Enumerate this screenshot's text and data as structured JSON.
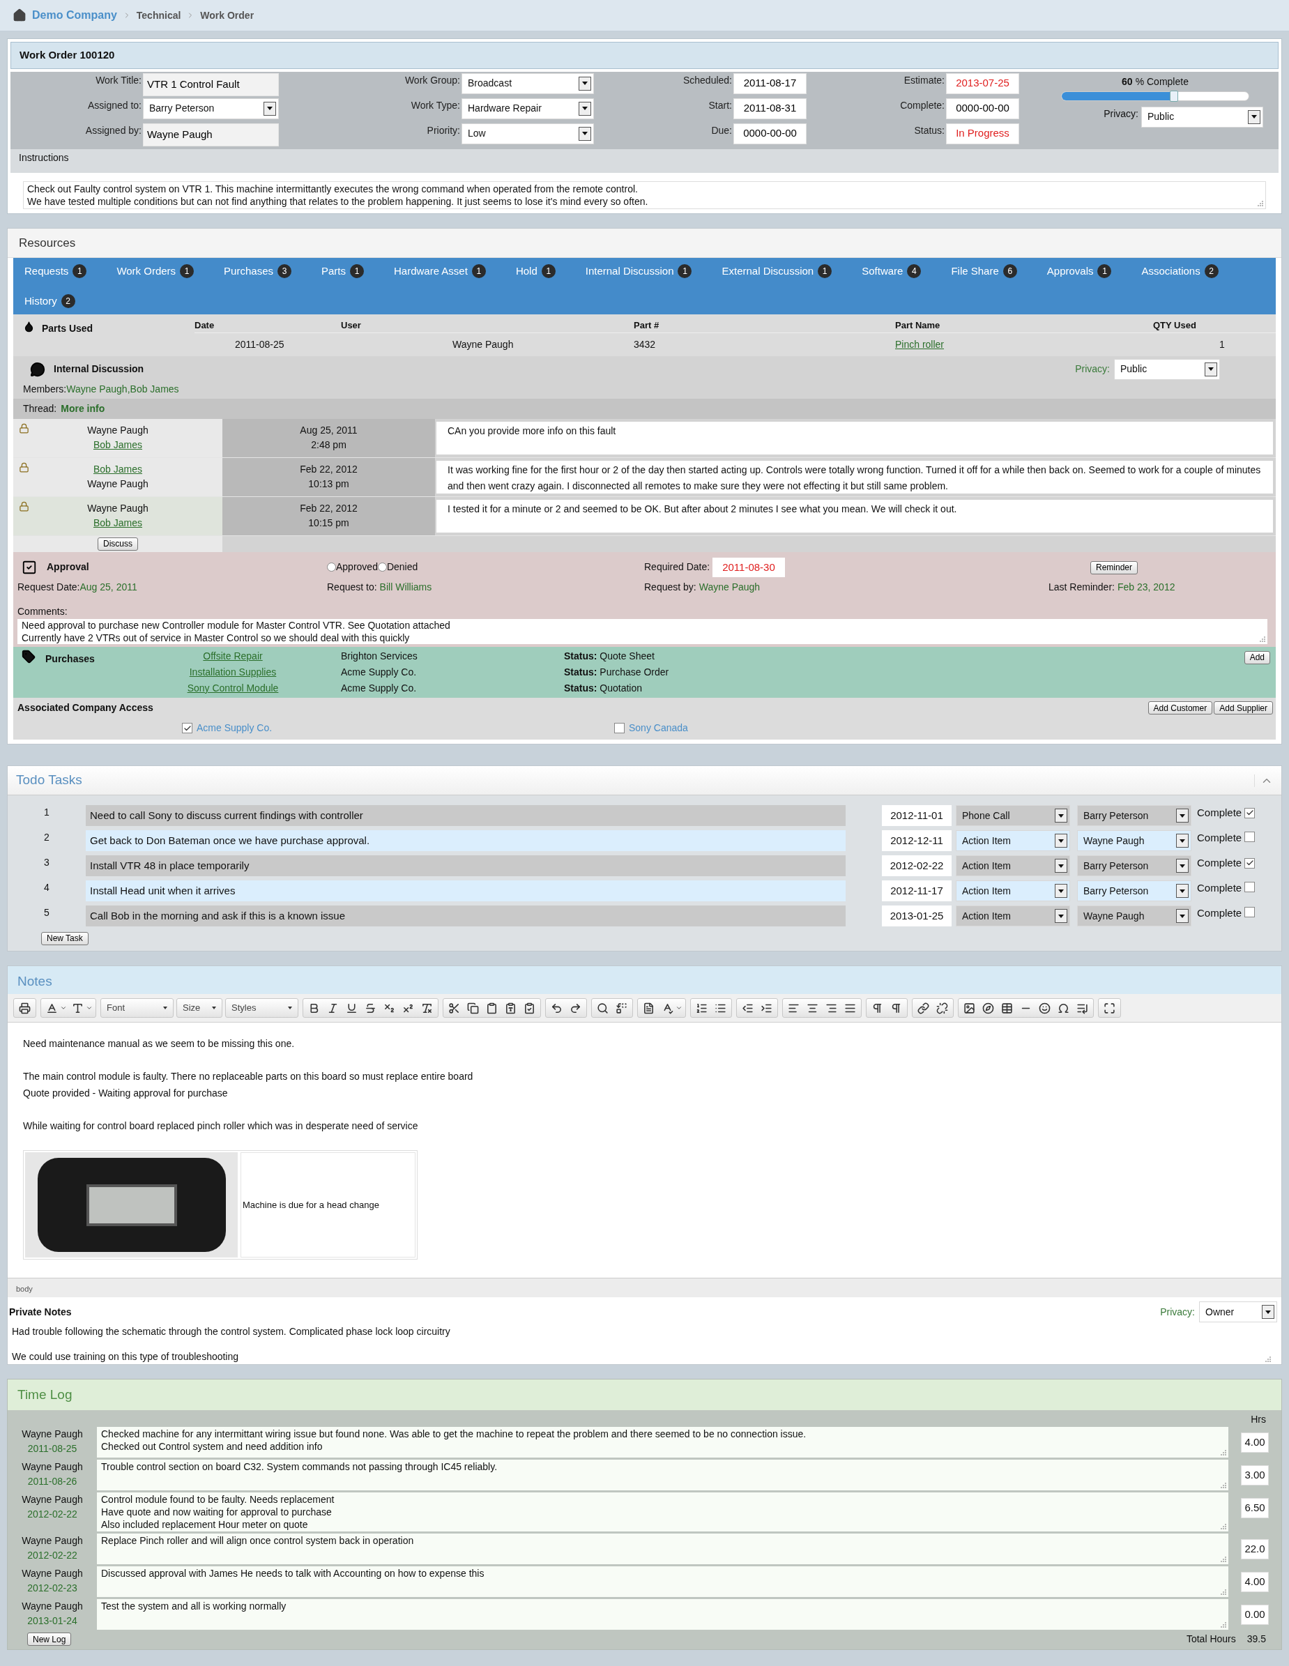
{
  "breadcrumb": [
    "Demo Company",
    "Technical",
    "Work Order"
  ],
  "work_order": {
    "title": "Work Order 100120",
    "columns": [
      [
        {
          "label": "Work Title:",
          "value": "VTR 1 Control Fault",
          "kind": "text",
          "alert": false
        },
        {
          "label": "Assigned to:",
          "value": "Barry Peterson",
          "kind": "select",
          "alert": false
        },
        {
          "label": "Assigned by:",
          "value": "Wayne Paugh",
          "kind": "text",
          "alert": false
        }
      ],
      [
        {
          "label": "Work Group:",
          "value": "Broadcast",
          "kind": "select",
          "alert": false
        },
        {
          "label": "Work Type:",
          "value": "Hardware Repair",
          "kind": "select",
          "alert": false
        },
        {
          "label": "Priority:",
          "value": "Low",
          "kind": "select",
          "alert": false
        }
      ],
      [
        {
          "label": "Scheduled:",
          "value": "2011-08-17",
          "kind": "box",
          "alert": false
        },
        {
          "label": "Start:",
          "value": "2011-08-31",
          "kind": "box",
          "alert": false
        },
        {
          "label": "Due:",
          "value": "0000-00-00",
          "kind": "box",
          "alert": false
        }
      ],
      [
        {
          "label": "Estimate:",
          "value": "2013-07-25",
          "kind": "box",
          "alert": true
        },
        {
          "label": "Complete:",
          "value": "0000-00-00",
          "kind": "box",
          "alert": false
        },
        {
          "label": "Status:",
          "value": "In Progress",
          "kind": "box",
          "alert": true
        }
      ]
    ],
    "progress": {
      "percent": "60",
      "label": "% Complete",
      "level": 0.6
    },
    "privacy": {
      "label": "Privacy:",
      "value": "Public"
    },
    "instructions": {
      "label": "Instructions",
      "lines": [
        "Check out Faulty control system on VTR 1. This machine intermittantly executes the wrong command when operated from the remote control.",
        "We have tested multiple conditions but can not find anything that relates to the problem happening. It just seems to lose it's mind every so often."
      ]
    }
  },
  "resources": {
    "title": "Resources",
    "tabs": [
      {
        "label": "Requests",
        "count": "1"
      },
      {
        "label": "Work Orders",
        "count": "1"
      },
      {
        "label": "Purchases",
        "count": "3"
      },
      {
        "label": "Parts",
        "count": "1"
      },
      {
        "label": "Hardware Asset",
        "count": "1"
      },
      {
        "label": "Hold",
        "count": "1"
      },
      {
        "label": "Internal Discussion",
        "count": "1"
      },
      {
        "label": "External Discussion",
        "count": "1"
      },
      {
        "label": "Software",
        "count": "4"
      },
      {
        "label": "File Share",
        "count": "6"
      },
      {
        "label": "Approvals",
        "count": "1"
      },
      {
        "label": "Associations",
        "count": "2"
      },
      {
        "label": "History",
        "count": "2"
      }
    ],
    "parts_used": {
      "title": "Parts Used",
      "columns": [
        "Date",
        "User",
        "Part #",
        "Part Name",
        "QTY Used"
      ],
      "rows": [
        {
          "date": "2011-08-25",
          "user": "Wayne Paugh",
          "part_no": "3432",
          "part_name": "Pinch roller",
          "qty": "1"
        }
      ]
    },
    "internal_discussion": {
      "title": "Internal Discussion",
      "privacy_label": "Privacy:",
      "privacy": "Public",
      "members_label": "Members:",
      "members": "Wayne Paugh,Bob James",
      "thread_label": "Thread:",
      "thread_link": "More info",
      "messages": [
        {
          "names": [
            {
              "name": "Wayne Paugh",
              "link": false
            },
            {
              "name": "Bob James",
              "link": true
            }
          ],
          "date": "Aug 25, 2011",
          "time": "2:48 pm",
          "text": "CAn you provide more info on this fault"
        },
        {
          "names": [
            {
              "name": "Bob James",
              "link": true
            },
            {
              "name": "Wayne Paugh",
              "link": false
            }
          ],
          "date": "Feb 22, 2012",
          "time": "10:13 pm",
          "text": "It was working fine for the first hour or 2 of the day then started acting up. Controls were totally wrong function. Turned it off for a while then back on. Seemed to work for a couple of minutes and then went crazy again. I disconnected all remotes to make sure they were not effecting it but still same problem."
        },
        {
          "names": [
            {
              "name": "Wayne Paugh",
              "link": false
            },
            {
              "name": "Bob James",
              "link": true
            }
          ],
          "date": "Feb 22, 2012",
          "time": "10:15 pm",
          "text": "I tested it for a minute or 2 and seemed to be OK. But after about 2 minutes I see what you mean. We will check it out."
        }
      ],
      "discuss_button": "Discuss"
    },
    "approval": {
      "title": "Approval",
      "options": [
        {
          "label": "Approved",
          "selected": false
        },
        {
          "label": "Denied",
          "selected": false
        }
      ],
      "required_date_label": "Required Date:",
      "required_date": "2011-08-30",
      "reminder_button": "Reminder",
      "request_date_label": "Request Date:",
      "request_date": "Aug 25, 2011",
      "request_to_label": "Request to:",
      "request_to": "Bill Williams",
      "request_by_label": "Request by:",
      "request_by": "Wayne Paugh",
      "last_reminder_label": "Last Reminder:",
      "last_reminder": "Feb 23, 2012",
      "comments_label": "Comments:",
      "comments": [
        "Need approval to purchase new Controller module for Master Control VTR. See Quotation attached",
        "Currently have 2 VTRs out of service in Master Control so we should deal with this quickly"
      ]
    },
    "purchases": {
      "title": "Purchases",
      "add_button": "Add",
      "items": [
        {
          "name": "Offsite Repair",
          "vendor": "Brighton Services",
          "status_label": "Status:",
          "status": "Quote Sheet"
        },
        {
          "name": "Installation Supplies",
          "vendor": "Acme Supply Co.",
          "status_label": "Status:",
          "status": "Purchase Order"
        },
        {
          "name": "Sony Control Module",
          "vendor": "Acme Supply Co.",
          "status_label": "Status:",
          "status": "Quotation"
        }
      ]
    },
    "associated": {
      "title": "Associated Company Access",
      "buttons": [
        "Add Customer",
        "Add Supplier"
      ],
      "companies": [
        {
          "name": "Acme Supply Co.",
          "checked": true
        },
        {
          "name": "Sony Canada",
          "checked": false
        }
      ]
    }
  },
  "todo": {
    "title": "Todo Tasks",
    "tasks": [
      {
        "number": "1",
        "text": "Need to call Sony to discuss current findings with controller",
        "date": "2012-11-01",
        "type": "Phone Call",
        "assignee": "Barry Peterson",
        "complete_label": "Complete",
        "checked": true
      },
      {
        "number": "2",
        "text": "Get back to Don Bateman once we have purchase approval.",
        "date": "2012-12-11",
        "type": "Action Item",
        "assignee": "Wayne Paugh",
        "complete_label": "Complete",
        "checked": false
      },
      {
        "number": "3",
        "text": "Install VTR 48 in place temporarily",
        "date": "2012-02-22",
        "type": "Action Item",
        "assignee": "Barry Peterson",
        "complete_label": "Complete",
        "checked": true
      },
      {
        "number": "4",
        "text": "Install Head unit when it arrives",
        "date": "2012-11-17",
        "type": "Action Item",
        "assignee": "Barry Peterson",
        "complete_label": "Complete",
        "checked": false
      },
      {
        "number": "5",
        "text": "Call Bob in the morning and ask if this is a known issue",
        "date": "2013-01-25",
        "type": "Action Item",
        "assignee": "Wayne Paugh",
        "complete_label": "Complete",
        "checked": false
      }
    ],
    "new_task_button": "New Task"
  },
  "notes": {
    "title": "Notes",
    "toolbar_dropdowns": [
      "Font",
      "Size",
      "Styles"
    ],
    "paragraphs": [
      [
        "Need maintenance manual as we seem to be missing this one."
      ],
      [
        "The main control module is faulty. There no replaceable parts on this board so must replace entire board",
        "Quote provided - Waiting approval for purchase"
      ],
      [
        "While waiting for control board replaced pinch roller which was in desperate need of service"
      ]
    ],
    "image_caption": "Machine is due for a head change",
    "path": "body"
  },
  "private_notes": {
    "title": "Private Notes",
    "privacy_label": "Privacy:",
    "privacy": "Owner",
    "paragraphs": [
      [
        "Had trouble following the schematic through the control system. Complicated phase lock loop circuitry"
      ],
      [
        "We could use training on this type of troubleshooting"
      ]
    ]
  },
  "time_log": {
    "title": "Time Log",
    "hrs_label": "Hrs",
    "entries": [
      {
        "user": "Wayne Paugh",
        "date": "2011-08-25",
        "lines": [
          "Checked machine for any intermittant wiring issue but found none. Was able to get the machine to repeat the problem and there seemed to be no connection issue.",
          "Checked out Control system and need addition info"
        ],
        "hours": "4.00"
      },
      {
        "user": "Wayne Paugh",
        "date": "2011-08-26",
        "lines": [
          "Trouble control section on board C32. System commands not passing through IC45 reliably."
        ],
        "hours": "3.00"
      },
      {
        "user": "Wayne Paugh",
        "date": "2012-02-22",
        "lines": [
          "Control module found to be faulty. Needs replacement",
          "Have quote and now waiting for approval to purchase",
          "Also included replacement Hour  meter on quote"
        ],
        "hours": "6.50"
      },
      {
        "user": "Wayne Paugh",
        "date": "2012-02-22",
        "lines": [
          "Replace Pinch roller and will align once control system back in operation"
        ],
        "hours": "22.0"
      },
      {
        "user": "Wayne Paugh",
        "date": "2012-02-23",
        "lines": [
          "Discussed approval with James He needs to talk with Accounting on how to expense this"
        ],
        "hours": "4.00"
      },
      {
        "user": "Wayne Paugh",
        "date": "2013-01-24",
        "lines": [
          "Test the system and all is working normally"
        ],
        "hours": "0.00"
      }
    ],
    "new_log_button": "New Log",
    "total_label": "Total Hours",
    "total": "39.5"
  }
}
